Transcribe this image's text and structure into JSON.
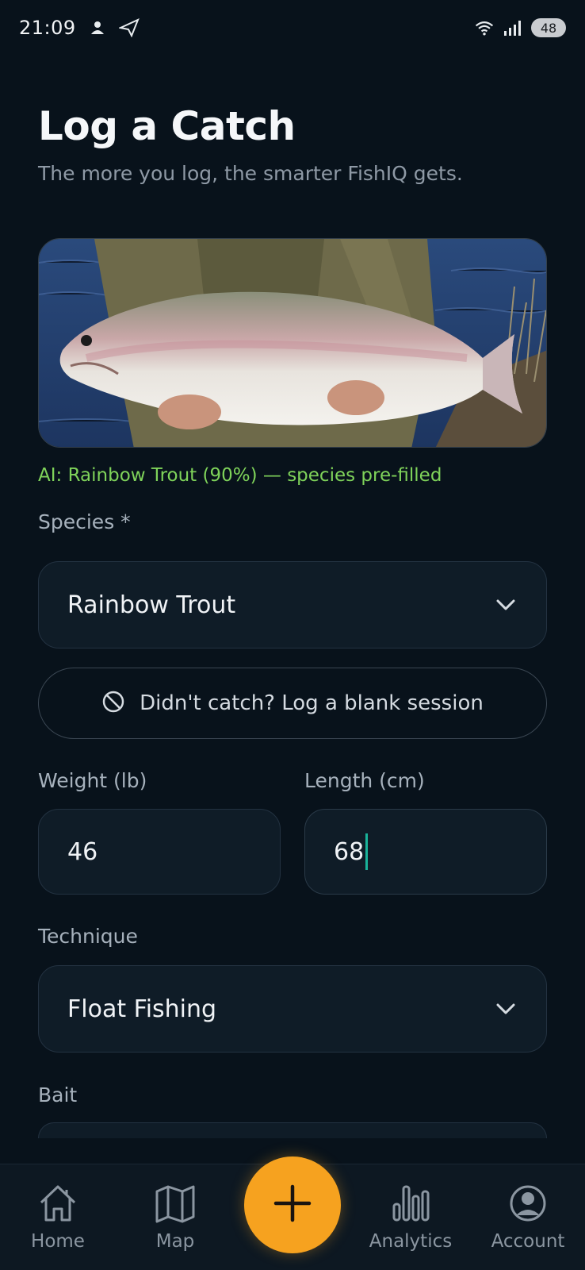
{
  "status_bar": {
    "time": "21:09",
    "battery": "48",
    "icons": [
      "notification-icon",
      "send-icon",
      "wifi-icon",
      "signal-icon"
    ]
  },
  "header": {
    "title": "Log a Catch",
    "subtitle": "The more you log, the smarter FishIQ gets."
  },
  "photo": {
    "subject": "rainbow-trout-photo"
  },
  "ai_hint": "AI: Rainbow Trout (90%) — species pre-filled",
  "species": {
    "label": "Species *",
    "value": "Rainbow Trout"
  },
  "blank_session": {
    "label": "Didn't catch? Log a blank session"
  },
  "weight": {
    "label": "Weight (lb)",
    "value": "46"
  },
  "length": {
    "label": "Length (cm)",
    "value": "68"
  },
  "technique": {
    "label": "Technique",
    "value": "Float Fishing"
  },
  "bait": {
    "label": "Bait"
  },
  "nav": {
    "items": [
      {
        "label": "Home",
        "icon": "home-icon"
      },
      {
        "label": "Map",
        "icon": "map-icon"
      },
      {
        "label": "",
        "icon": "plus-icon"
      },
      {
        "label": "Analytics",
        "icon": "analytics-icon"
      },
      {
        "label": "Account",
        "icon": "account-icon"
      }
    ]
  },
  "colors": {
    "background": "#08121b",
    "accent": "#f6a21f",
    "ai_green": "#7fd35a",
    "caret": "#19b39a"
  }
}
